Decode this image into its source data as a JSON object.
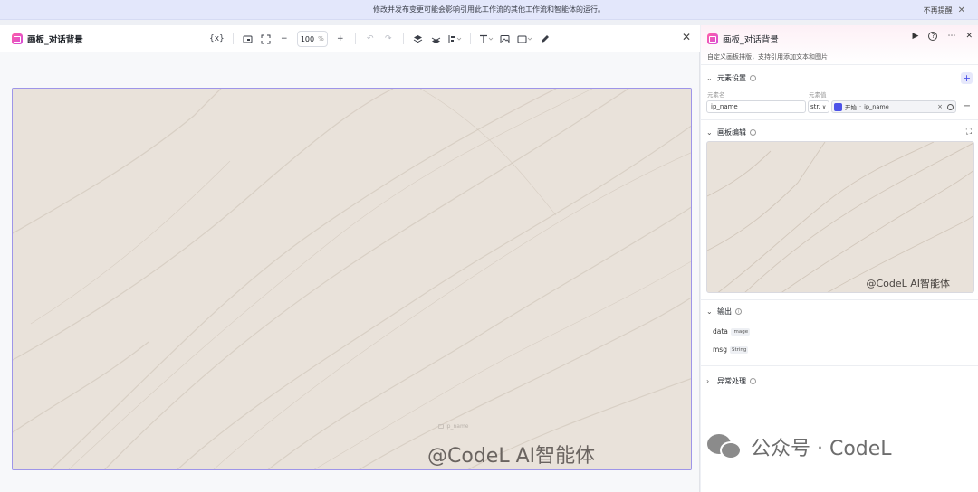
{
  "banner": {
    "message": "修改并发布变更可能会影响引用此工作流的其他工作流和智能体的运行。",
    "dismiss_label": "不再提醒"
  },
  "canvas_editor": {
    "title": "画板_对话背景",
    "toolbar": {
      "variable_label": "{x}",
      "zoom_value": "100",
      "zoom_unit": "%"
    },
    "placeholder_label": "ip_name",
    "watermark": "@CodeL AI智能体",
    "background_color": "#e9e2da",
    "selection_color": "#9e95e8"
  },
  "panel": {
    "title": "画板_对话背景",
    "description": "自定义画板排版，支持引用添加文本和图片",
    "element_settings": {
      "title": "元素设置",
      "col_name": "元素名",
      "col_value": "元素值",
      "name_value": "ip_name",
      "type_value": "str.",
      "ref_source": "开始",
      "ref_var": "ip_name"
    },
    "board_edit": {
      "title": "画板编辑",
      "preview_watermark": "@CodeL AI智能体"
    },
    "output": {
      "title": "输出",
      "rows": [
        {
          "name": "data",
          "type": "Image"
        },
        {
          "name": "msg",
          "type": "String"
        }
      ]
    },
    "error_handling": {
      "title": "异常处理"
    }
  },
  "watermark_footer": {
    "text": "公众号 · CodeL"
  },
  "colors": {
    "accent": "#4d53e8",
    "node_icon": "#e05bc4"
  }
}
